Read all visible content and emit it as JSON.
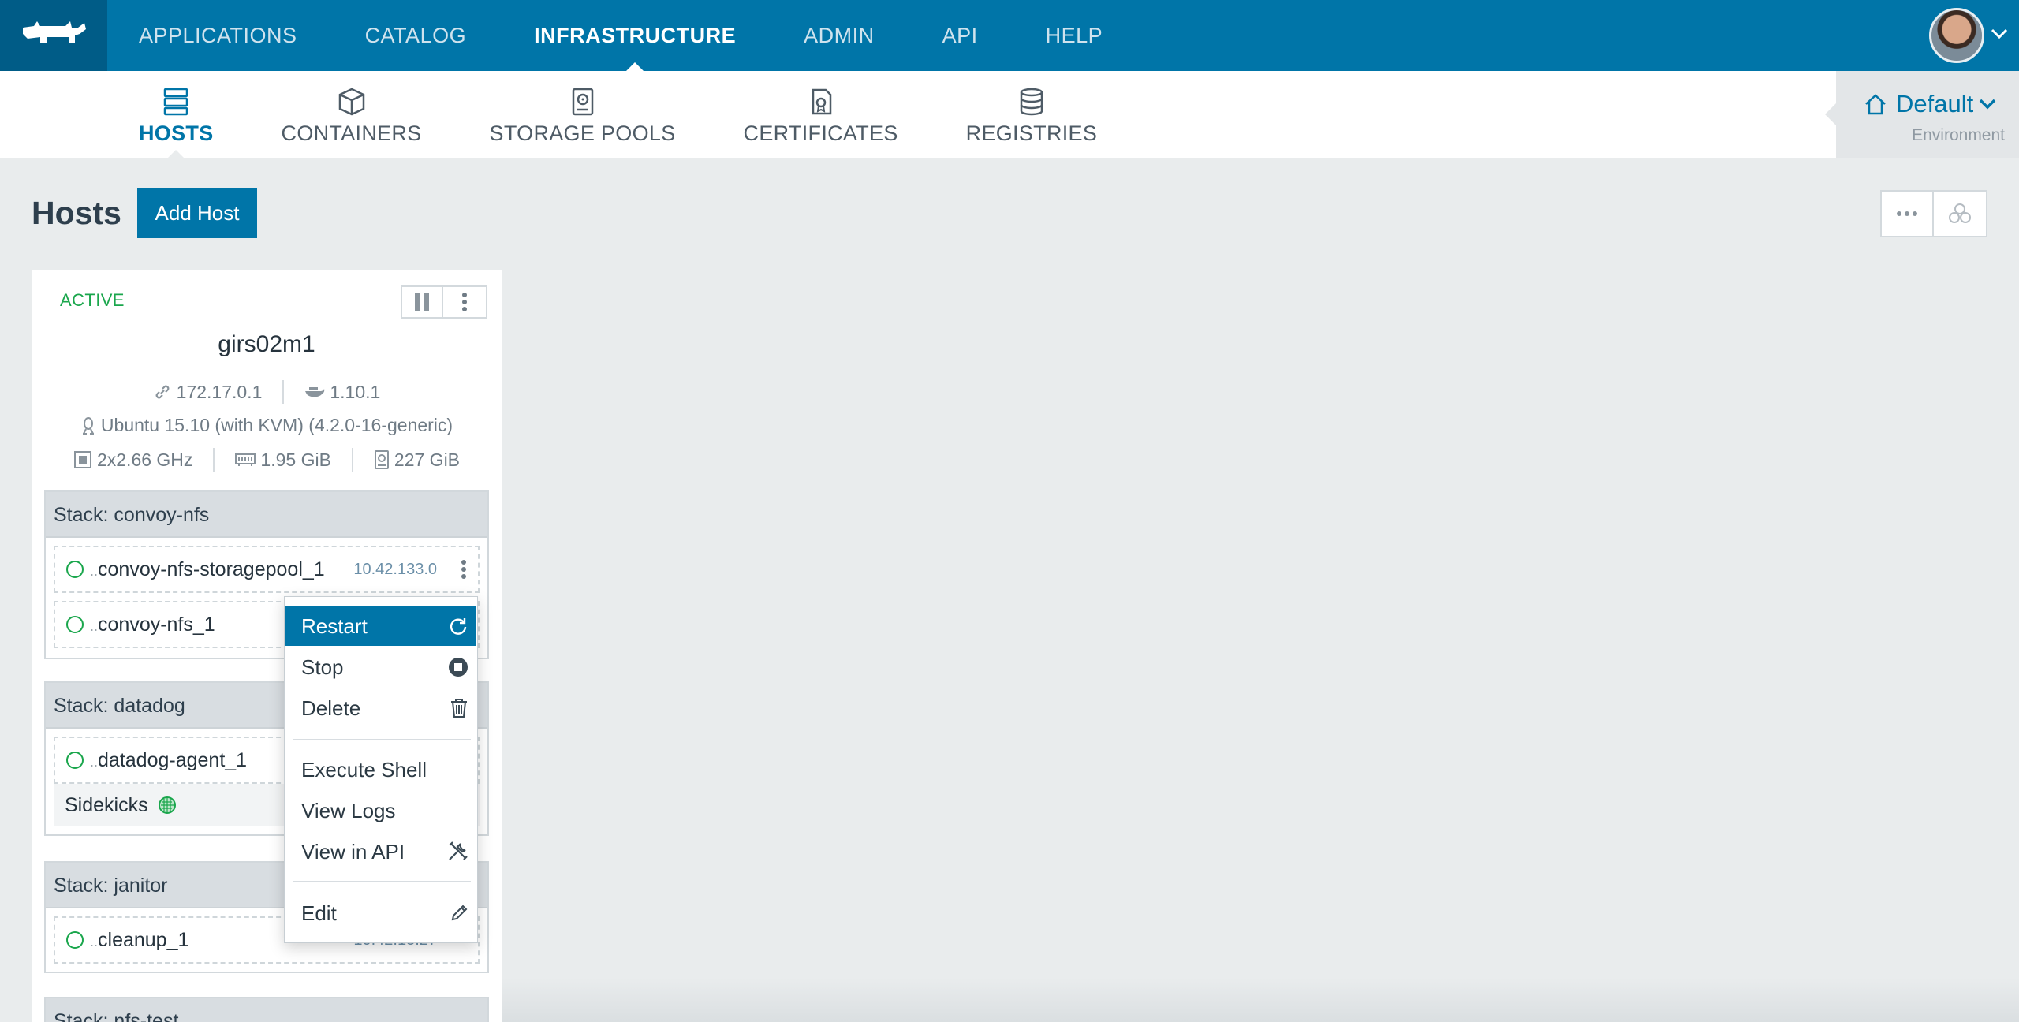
{
  "topnav": {
    "items": [
      {
        "label": "APPLICATIONS",
        "active": false
      },
      {
        "label": "CATALOG",
        "active": false
      },
      {
        "label": "INFRASTRUCTURE",
        "active": true
      },
      {
        "label": "ADMIN",
        "active": false
      },
      {
        "label": "API",
        "active": false
      },
      {
        "label": "HELP",
        "active": false
      }
    ]
  },
  "subnav": {
    "items": [
      {
        "label": "HOSTS",
        "icon": "hosts-icon",
        "active": true
      },
      {
        "label": "CONTAINERS",
        "icon": "container-icon",
        "active": false
      },
      {
        "label": "STORAGE POOLS",
        "icon": "storage-pool-icon",
        "active": false
      },
      {
        "label": "CERTIFICATES",
        "icon": "certificate-icon",
        "active": false
      },
      {
        "label": "REGISTRIES",
        "icon": "registry-icon",
        "active": false
      }
    ]
  },
  "environment": {
    "name": "Default",
    "label": "Environment"
  },
  "page": {
    "title": "Hosts",
    "add_button": "Add Host"
  },
  "host": {
    "state": "ACTIVE",
    "name": "girs02m1",
    "ip": "172.17.0.1",
    "docker_version": "1.10.1",
    "os": "Ubuntu 15.10 (with KVM) (4.2.0-16-generic)",
    "cpu": "2x2.66 GHz",
    "memory": "1.95 GiB",
    "storage": "227 GiB"
  },
  "stacks": [
    {
      "label": "Stack: convoy-nfs",
      "containers": [
        {
          "prefix": "..",
          "name": "convoy-nfs-storagepool_1",
          "ip": "10.42.133.0"
        },
        {
          "prefix": "..",
          "name": "convoy-nfs_1",
          "ip": ""
        }
      ]
    },
    {
      "label": "Stack: datadog",
      "containers": [
        {
          "prefix": "..",
          "name": "datadog-agent_1",
          "ip": ""
        }
      ],
      "sidekicks_label": "Sidekicks"
    },
    {
      "label": "Stack: janitor",
      "containers": [
        {
          "prefix": "..",
          "name": "cleanup_1",
          "ip": "10.42.15.27"
        }
      ]
    },
    {
      "label": "Stack: nfs-test",
      "containers": []
    }
  ],
  "context_menu": {
    "restart": "Restart",
    "stop": "Stop",
    "delete": "Delete",
    "execute_shell": "Execute Shell",
    "view_logs": "View Logs",
    "view_in_api": "View in API",
    "edit": "Edit"
  },
  "colors": {
    "brand": "#0075a8",
    "brand_dark": "#005c87",
    "active_state": "#1aa64c",
    "background": "#e9eced"
  }
}
